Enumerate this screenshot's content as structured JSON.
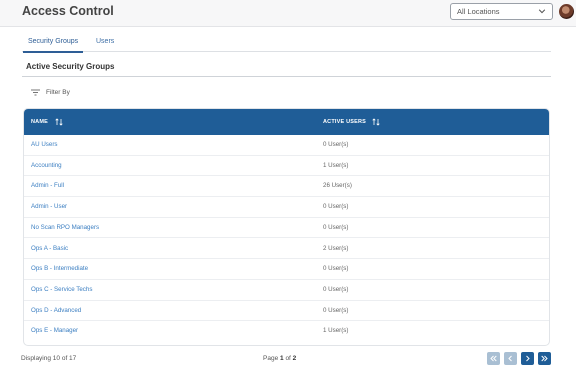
{
  "header": {
    "title": "Access Control",
    "location_select_value": "All Locations"
  },
  "tabs": [
    {
      "label": "Security Groups",
      "active": true
    },
    {
      "label": "Users",
      "active": false
    }
  ],
  "section": {
    "title": "Active Security Groups",
    "filter_label": "Filter By"
  },
  "table": {
    "columns": [
      "NAME",
      "ACTIVE USERS"
    ],
    "rows": [
      {
        "name": "AU Users",
        "users": "0 User(s)"
      },
      {
        "name": "Accounting",
        "users": "1 User(s)"
      },
      {
        "name": "Admin - Full",
        "users": "26 User(s)"
      },
      {
        "name": "Admin - User",
        "users": "0 User(s)"
      },
      {
        "name": "No Scan RPO Managers",
        "users": "0 User(s)"
      },
      {
        "name": "Ops A - Basic",
        "users": "2 User(s)"
      },
      {
        "name": "Ops B - Intermediate",
        "users": "0 User(s)"
      },
      {
        "name": "Ops C - Service Techs",
        "users": "0 User(s)"
      },
      {
        "name": "Ops D - Advanced",
        "users": "0 User(s)"
      },
      {
        "name": "Ops E - Manager",
        "users": "1 User(s)"
      }
    ]
  },
  "footer": {
    "displaying": "Displaying 10 of 17",
    "page_prefix": "Page",
    "current_page": "1",
    "page_of": "of",
    "total_pages": "2"
  },
  "colors": {
    "accent": "#1f5d97",
    "link": "#3c7fc2",
    "disabled_button": "#a9bfd3"
  }
}
